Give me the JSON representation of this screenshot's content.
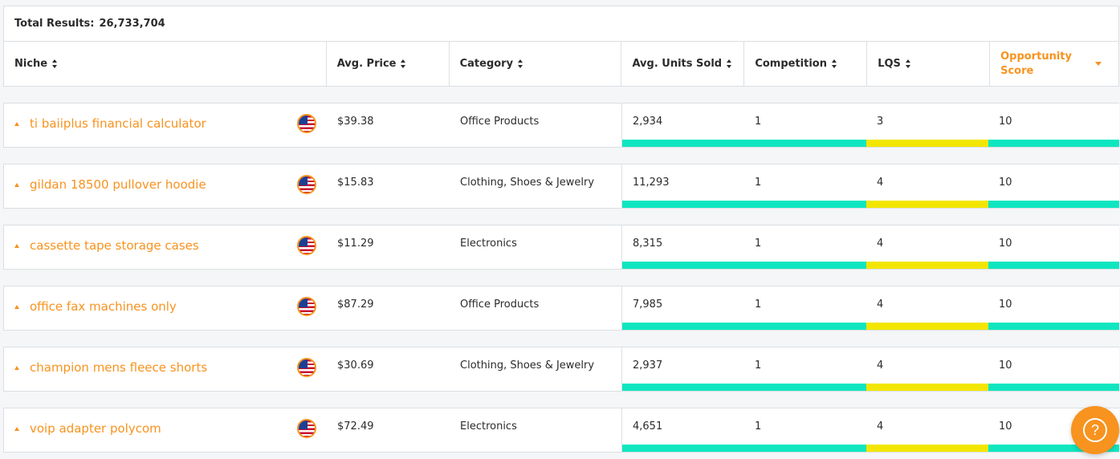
{
  "summary": {
    "label": "Total Results:",
    "count": "26,733,704"
  },
  "columns": {
    "niche": "Niche",
    "avg_price": "Avg. Price",
    "category": "Category",
    "avg_units": "Avg. Units Sold",
    "competition": "Competition",
    "lqs": "LQS",
    "opportunity": "Opportunity Score"
  },
  "colors": {
    "accent": "#f7931e",
    "good": "#0fe6c0",
    "medium": "#f2e600"
  },
  "rows": [
    {
      "niche": "ti baiiplus financial calculator",
      "price": "$39.38",
      "category": "Office Products",
      "units": "2,934",
      "competition": "1",
      "lqs": "3",
      "opportunity": "10",
      "flag": "us-flag-icon"
    },
    {
      "niche": "gildan 18500 pullover hoodie",
      "price": "$15.83",
      "category": "Clothing, Shoes & Jewelry",
      "units": "11,293",
      "competition": "1",
      "lqs": "4",
      "opportunity": "10",
      "flag": "us-flag-icon"
    },
    {
      "niche": "cassette tape storage cases",
      "price": "$11.29",
      "category": "Electronics",
      "units": "8,315",
      "competition": "1",
      "lqs": "4",
      "opportunity": "10",
      "flag": "us-flag-icon"
    },
    {
      "niche": "office fax machines only",
      "price": "$87.29",
      "category": "Office Products",
      "units": "7,985",
      "competition": "1",
      "lqs": "4",
      "opportunity": "10",
      "flag": "us-flag-icon"
    },
    {
      "niche": "champion mens fleece shorts",
      "price": "$30.69",
      "category": "Clothing, Shoes & Jewelry",
      "units": "2,937",
      "competition": "1",
      "lqs": "4",
      "opportunity": "10",
      "flag": "us-flag-icon"
    },
    {
      "niche": "voip adapter polycom",
      "price": "$72.49",
      "category": "Electronics",
      "units": "4,651",
      "competition": "1",
      "lqs": "4",
      "opportunity": "10",
      "flag": "us-flag-icon"
    }
  ],
  "help": {
    "icon": "question-icon",
    "glyph": "?"
  }
}
